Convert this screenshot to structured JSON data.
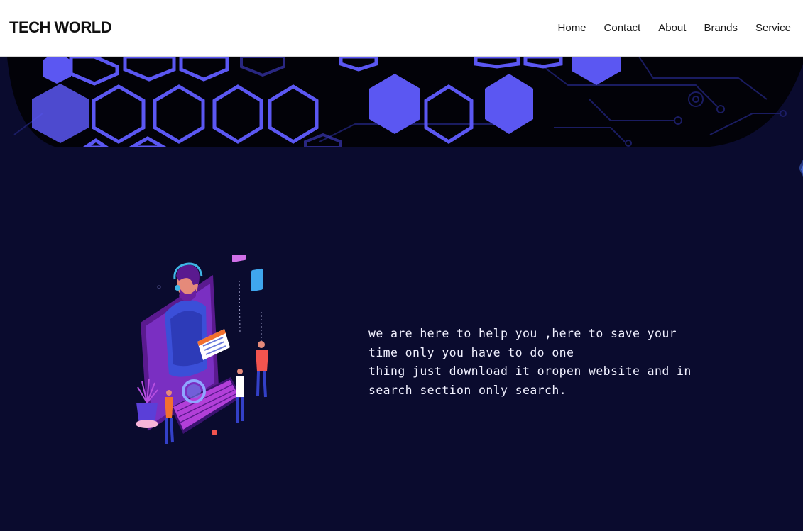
{
  "navbar": {
    "brand": "TECH WORLD",
    "links": [
      "Home",
      "Contact",
      "About",
      "Brands",
      "Service"
    ]
  },
  "hero": {
    "message_lines": [
      "we are here to help you ,here to save your",
      "time only you have to do one",
      "thing just download it oropen website and in",
      "search section only search."
    ]
  },
  "colors": {
    "background": "#0a0b2e",
    "navbar": "#ffffff",
    "hexagon_accent": "#5b57f2",
    "circuit_black": "#020208"
  }
}
